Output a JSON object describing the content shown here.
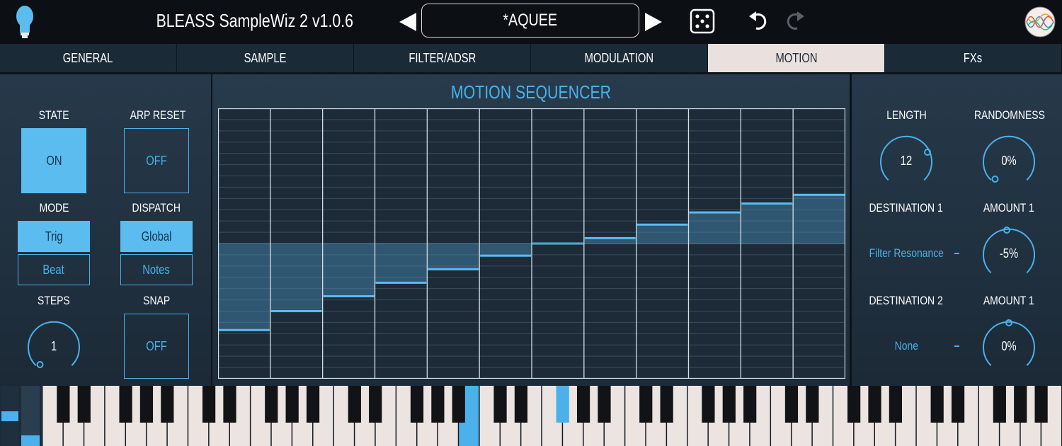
{
  "header": {
    "app_title": "BLEASS SampleWiz 2  v1.0.6",
    "preset_name": "*AQUEE",
    "icons": [
      "lightbulb-logo-icon",
      "triangle-left-icon",
      "triangle-right-icon",
      "dice-icon",
      "undo-icon",
      "redo-icon",
      "waveform-avatar-icon"
    ]
  },
  "tabs": [
    {
      "label": "GENERAL",
      "active": false
    },
    {
      "label": "SAMPLE",
      "active": false
    },
    {
      "label": "FILTER/ADSR",
      "active": false
    },
    {
      "label": "MODULATION",
      "active": false
    },
    {
      "label": "MOTION",
      "active": true
    },
    {
      "label": "FXs",
      "active": false
    }
  ],
  "left": {
    "state": {
      "label": "STATE",
      "value": "ON"
    },
    "arp_reset": {
      "label": "ARP RESET",
      "value": "OFF"
    },
    "mode": {
      "label": "MODE",
      "options": [
        "Trig",
        "Beat"
      ],
      "selected": "Trig"
    },
    "dispatch": {
      "label": "DISPATCH",
      "options": [
        "Global",
        "Notes"
      ],
      "selected": "Global"
    },
    "steps": {
      "label": "STEPS",
      "value": "1"
    },
    "snap": {
      "label": "SNAP",
      "value": "OFF"
    }
  },
  "center": {
    "title": "MOTION SEQUENCER"
  },
  "sequencer": {
    "steps": 12,
    "rows": 24,
    "baseline_fraction": 0.5,
    "step_values": [
      -0.32,
      -0.25,
      -0.195,
      -0.145,
      -0.095,
      -0.045,
      0.0,
      0.02,
      0.07,
      0.115,
      0.148,
      0.18
    ]
  },
  "right": {
    "length": {
      "label": "LENGTH",
      "value": "12"
    },
    "randomness": {
      "label": "RANDOMNESS",
      "value": "0%"
    },
    "destination1": {
      "label": "DESTINATION 1",
      "value": "Filter Resonance"
    },
    "amount1": {
      "label": "AMOUNT 1",
      "value": "-5%"
    },
    "destination2": {
      "label": "DESTINATION 2",
      "value": "None"
    },
    "amount2": {
      "label": "AMOUNT 1",
      "value": "0%"
    }
  },
  "keyboard": {
    "highlighted_white_keys": [
      20
    ],
    "highlighted_black_keys": [
      17
    ]
  },
  "colors": {
    "accent": "#5bbcf0",
    "accent_line": "#4ab1ea",
    "panel": "#223444",
    "tab_active": "#eae1df",
    "top_bar": "#0c0f13"
  }
}
